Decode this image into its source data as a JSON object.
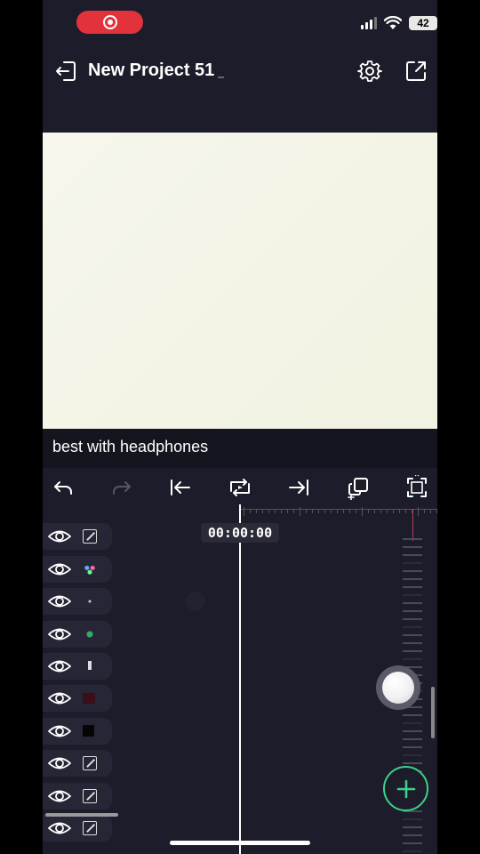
{
  "status_bar": {
    "battery": "42",
    "recording_icon": "screen-record-icon",
    "signal_icon": "cellular-signal-icon",
    "wifi_icon": "wifi-icon",
    "record_color": "#e2323c"
  },
  "header": {
    "title": "New Project 51",
    "back_icon": "exit-icon",
    "settings_icon": "gear-icon",
    "share_icon": "share-icon"
  },
  "canvas": {
    "background": "#f4f4e6"
  },
  "subtitle": {
    "text": "best with headphones"
  },
  "toolbar": {
    "buttons": [
      {
        "name": "undo",
        "icon": "undo-icon",
        "enabled": true
      },
      {
        "name": "redo",
        "icon": "redo-icon",
        "enabled": false
      },
      {
        "name": "jump-to-start",
        "icon": "skip-to-start-icon",
        "enabled": true
      },
      {
        "name": "loop",
        "icon": "loop-icon",
        "enabled": true
      },
      {
        "name": "jump-to-end",
        "icon": "skip-to-end-icon",
        "enabled": true
      },
      {
        "name": "duplicate",
        "icon": "duplicate-icon",
        "enabled": true
      },
      {
        "name": "fullscreen",
        "icon": "fullscreen-icon",
        "enabled": true
      }
    ]
  },
  "timeline": {
    "time": "00:00:00",
    "layers": [
      {
        "visible_icon": "eye-icon",
        "thumb": "frame"
      },
      {
        "visible_icon": "eye-icon",
        "thumb": "dots"
      },
      {
        "visible_icon": "eye-icon",
        "thumb": "speck"
      },
      {
        "visible_icon": "eye-icon",
        "thumb": "green-dot"
      },
      {
        "visible_icon": "eye-icon",
        "thumb": "figure"
      },
      {
        "visible_icon": "eye-icon",
        "thumb": "dark-red"
      },
      {
        "visible_icon": "eye-icon",
        "thumb": "black"
      },
      {
        "visible_icon": "eye-icon",
        "thumb": "frame"
      },
      {
        "visible_icon": "eye-icon",
        "thumb": "frame"
      },
      {
        "visible_icon": "eye-icon",
        "thumb": "frame"
      }
    ]
  },
  "actions": {
    "add_icon": "plus-icon",
    "add_color": "#3bd18a"
  }
}
